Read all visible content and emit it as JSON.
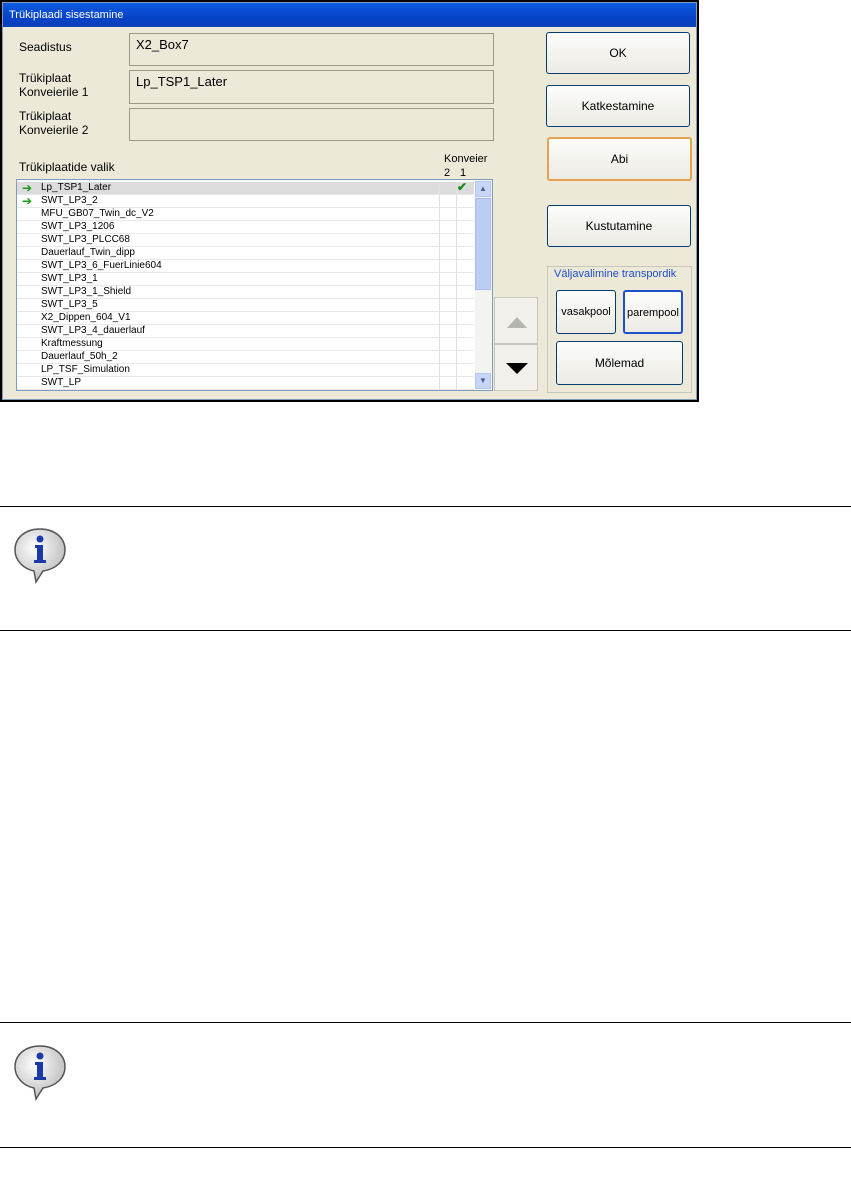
{
  "dialog": {
    "title": "Trükiplaadi sisestamine",
    "fields": [
      {
        "label": "Seadistus",
        "value": "X2_Box7"
      },
      {
        "label_line1": "Trükiplaat",
        "label_line2": "Konveierile 1",
        "value": "Lp_TSP1_Later"
      },
      {
        "label_line1": "Trükiplaat",
        "label_line2": "Konveierile 2",
        "value": ""
      }
    ],
    "list_label": "Trükiplaatide valik",
    "col_header_top": "Konveier",
    "col_header_2": "2",
    "col_header_1": "1",
    "items": [
      "Lp_TSP1_Later",
      "SWT_LP3_2",
      "MFU_GB07_Twin_dc_V2",
      "SWT_LP3_1206",
      "SWT_LP3_PLCC68",
      "Dauerlauf_Twin_dipp",
      "SWT_LP3_6_FuerLinie604",
      "SWT_LP3_1",
      "SWT_LP3_1_Shield",
      "SWT_LP3_5",
      "X2_Dippen_604_V1",
      "SWT_LP3_4_dauerlauf",
      "Kraftmessung",
      "Dauerlauf_50h_2",
      "LP_TSF_Simulation",
      "SWT_LP"
    ],
    "buttons": {
      "ok": "OK",
      "cancel": "Katkestamine",
      "help": "Abi",
      "delete": "Kustutamine",
      "left": "vasakpool",
      "right": "parempool",
      "both": "Mõlemad"
    },
    "group_title": "Väljavalimine transpordik",
    "icons": {
      "arrow": "green-arrow-icon",
      "check": "green-check-icon",
      "up": "triangle-up-icon",
      "down": "triangle-down-icon",
      "info": "info-speech-bubble-icon"
    }
  }
}
